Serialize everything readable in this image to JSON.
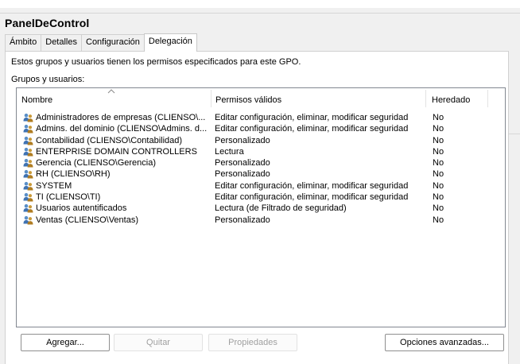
{
  "title": "PanelDeControl",
  "tabs": [
    {
      "label": "Ámbito"
    },
    {
      "label": "Detalles"
    },
    {
      "label": "Configuración"
    },
    {
      "label": "Delegación"
    }
  ],
  "active_tab": "Delegación",
  "description": "Estos grupos y usuarios tienen los permisos especificados para este GPO.",
  "groups_label": "Grupos y usuarios:",
  "columns": {
    "name": "Nombre",
    "permissions": "Permisos válidos",
    "inherited": "Heredado"
  },
  "rows": [
    {
      "name": "Administradores de empresas (CLIENSO\\...",
      "permissions": "Editar configuración, eliminar, modificar seguridad",
      "inherited": "No"
    },
    {
      "name": "Admins. del dominio (CLIENSO\\Admins. d...",
      "permissions": "Editar configuración, eliminar, modificar seguridad",
      "inherited": "No"
    },
    {
      "name": "Contabilidad (CLIENSO\\Contabilidad)",
      "permissions": "Personalizado",
      "inherited": "No"
    },
    {
      "name": "ENTERPRISE DOMAIN CONTROLLERS",
      "permissions": "Lectura",
      "inherited": "No"
    },
    {
      "name": "Gerencia (CLIENSO\\Gerencia)",
      "permissions": "Personalizado",
      "inherited": "No"
    },
    {
      "name": "RH (CLIENSO\\RH)",
      "permissions": "Personalizado",
      "inherited": "No"
    },
    {
      "name": "SYSTEM",
      "permissions": "Editar configuración, eliminar, modificar seguridad",
      "inherited": "No"
    },
    {
      "name": "TI (CLIENSO\\TI)",
      "permissions": "Editar configuración, eliminar, modificar seguridad",
      "inherited": "No"
    },
    {
      "name": "Usuarios autentificados",
      "permissions": "Lectura (de Filtrado de seguridad)",
      "inherited": "No"
    },
    {
      "name": "Ventas (CLIENSO\\Ventas)",
      "permissions": "Personalizado",
      "inherited": "No"
    }
  ],
  "buttons": {
    "add": "Agregar...",
    "remove": "Quitar",
    "properties": "Propiedades",
    "advanced": "Opciones avanzadas..."
  },
  "icons": {
    "row_icon": "user-group-icon",
    "sort_indicator": "sort-ascending-icon"
  },
  "colors": {
    "background": "#f0f0f0",
    "panel": "#ffffff",
    "list_border": "#828790",
    "disabled_text": "#a0a0a0"
  }
}
